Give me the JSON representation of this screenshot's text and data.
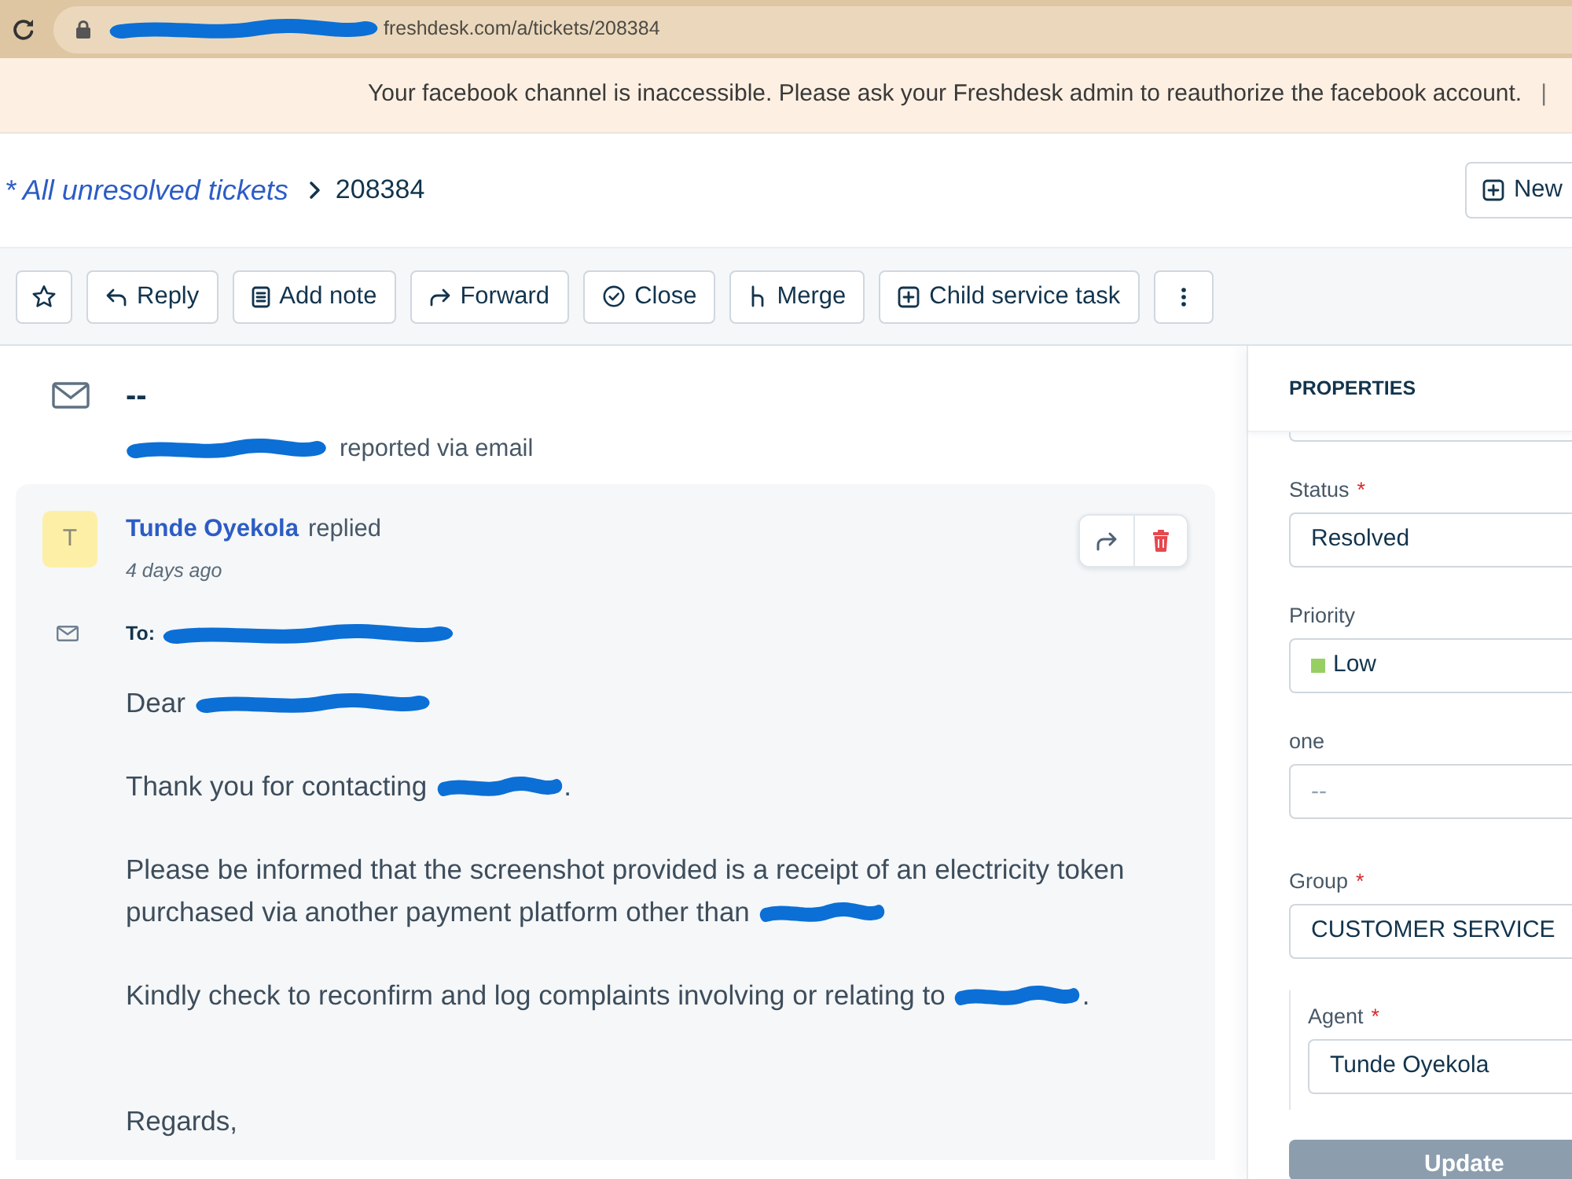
{
  "browser": {
    "url": [
      {
        "kind": "redaction"
      },
      {
        "kind": "text",
        "text": "freshdesk.com/a/tickets/208384"
      }
    ]
  },
  "banner": {
    "message": "Your facebook channel is inaccessible. Please ask your Freshdesk admin to reauthorize the facebook account.",
    "divider": "|"
  },
  "header": {
    "breadcrumb": "* All unresolved tickets",
    "ticket_id": "208384",
    "new_button": "New"
  },
  "toolbar": [
    {
      "kind": "star",
      "starred": false
    },
    {
      "kind": "reply",
      "label": "Reply"
    },
    {
      "kind": "note",
      "label": "Add note"
    },
    {
      "kind": "forward",
      "label": "Forward"
    },
    {
      "kind": "close",
      "label": "Close"
    },
    {
      "kind": "merge",
      "label": "Merge"
    },
    {
      "kind": "child_task",
      "label": "Child service task"
    },
    {
      "kind": "more"
    }
  ],
  "ticket": {
    "subject": "--",
    "source": [
      {
        "kind": "redaction"
      },
      {
        "kind": "text",
        "text": "reported via email"
      }
    ]
  },
  "conversation": {
    "avatar": "T",
    "author": "Tunde Oyekola",
    "action": "replied",
    "time": "4 days ago",
    "recipients": [
      {
        "kind": "text",
        "text": "To:"
      },
      {
        "kind": "redaction"
      }
    ],
    "body": [
      {
        "lines": [
          [
            {
              "kind": "text",
              "text": "Dear"
            },
            {
              "kind": "redaction"
            }
          ]
        ]
      },
      {
        "lines": [
          [
            {
              "kind": "text",
              "text": "Thank you for contacting"
            },
            {
              "kind": "redaction"
            },
            {
              "kind": "text",
              "text": "."
            }
          ]
        ]
      },
      {
        "lines": [
          [
            {
              "kind": "text",
              "text": "Please be informed that the screenshot provided is a receipt of an electricity token"
            }
          ],
          [
            {
              "kind": "text",
              "text": "purchased via another payment platform other than"
            },
            {
              "kind": "redaction"
            }
          ]
        ]
      },
      {
        "lines": [
          [
            {
              "kind": "text",
              "text": "Kindly check to reconfirm and log complaints involving or relating to"
            },
            {
              "kind": "redaction"
            },
            {
              "kind": "text",
              "text": "."
            }
          ]
        ]
      },
      {
        "lines": [
          [
            {
              "kind": "text",
              "text": "Regards,"
            }
          ]
        ]
      }
    ]
  },
  "properties": {
    "title": "PROPERTIES",
    "fields": [
      {
        "label": "Status",
        "required_mark": "*",
        "value": "Resolved"
      },
      {
        "label": "Priority",
        "value": "Low",
        "color": "#97cf62"
      },
      {
        "label": "one",
        "placeholder": "--"
      },
      {
        "label": "Group",
        "required_mark": "*",
        "value": "CUSTOMER SERVICE",
        "children": [
          {
            "label": "Agent",
            "required_mark": "*",
            "value": "Tunde Oyekola"
          }
        ]
      }
    ],
    "submit": "Update"
  }
}
